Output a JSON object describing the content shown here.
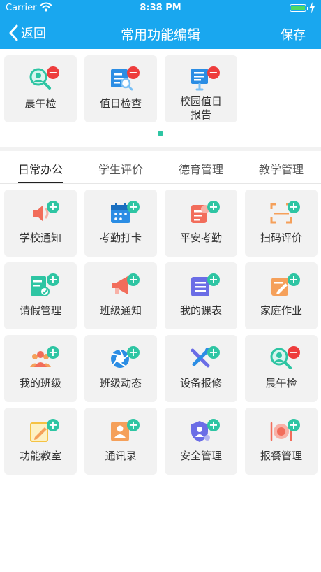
{
  "status_bar": {
    "carrier": "Carrier",
    "time": "8:38 PM"
  },
  "nav": {
    "back_label": "返回",
    "title": "常用功能编辑",
    "save_label": "保存"
  },
  "favorites": [
    {
      "label": "晨午检",
      "icon": "health-check-icon",
      "action": "remove"
    },
    {
      "label": "值日检查",
      "icon": "duty-inspection-icon",
      "action": "remove"
    },
    {
      "label": "校园值日报告",
      "label_line1": "校园值日",
      "label_line2": "报告",
      "icon": "campus-duty-report-icon",
      "action": "remove"
    }
  ],
  "tabs": [
    {
      "label": "日常办公",
      "active": true
    },
    {
      "label": "学生评价",
      "active": false
    },
    {
      "label": "德育管理",
      "active": false
    },
    {
      "label": "教学管理",
      "active": false
    }
  ],
  "functions": [
    {
      "label": "学校通知",
      "icon": "speaker-icon",
      "action": "add"
    },
    {
      "label": "考勤打卡",
      "icon": "calendar-icon",
      "action": "add"
    },
    {
      "label": "平安考勤",
      "icon": "safety-attendance-icon",
      "action": "add"
    },
    {
      "label": "扫码评价",
      "icon": "scan-icon",
      "action": "add"
    },
    {
      "label": "请假管理",
      "icon": "leave-form-icon",
      "action": "add"
    },
    {
      "label": "班级通知",
      "icon": "megaphone-icon",
      "action": "add"
    },
    {
      "label": "我的课表",
      "icon": "schedule-icon",
      "action": "add"
    },
    {
      "label": "家庭作业",
      "icon": "homework-icon",
      "action": "add"
    },
    {
      "label": "我的班级",
      "icon": "class-people-icon",
      "action": "add"
    },
    {
      "label": "班级动态",
      "icon": "camera-shutter-icon",
      "action": "add"
    },
    {
      "label": "设备报修",
      "icon": "repair-tools-icon",
      "action": "add"
    },
    {
      "label": "晨午检",
      "icon": "health-check-icon",
      "action": "remove"
    },
    {
      "label": "功能教室",
      "icon": "classroom-edit-icon",
      "action": "add"
    },
    {
      "label": "通讯录",
      "icon": "contacts-icon",
      "action": "add"
    },
    {
      "label": "安全管理",
      "icon": "security-shield-icon",
      "action": "add"
    },
    {
      "label": "报餐管理",
      "icon": "meal-plate-icon",
      "action": "add"
    }
  ],
  "colors": {
    "primary": "#19a7ef",
    "add": "#2ec5a3",
    "remove": "#ee3d3d",
    "tile_bg": "#f2f2f2"
  }
}
